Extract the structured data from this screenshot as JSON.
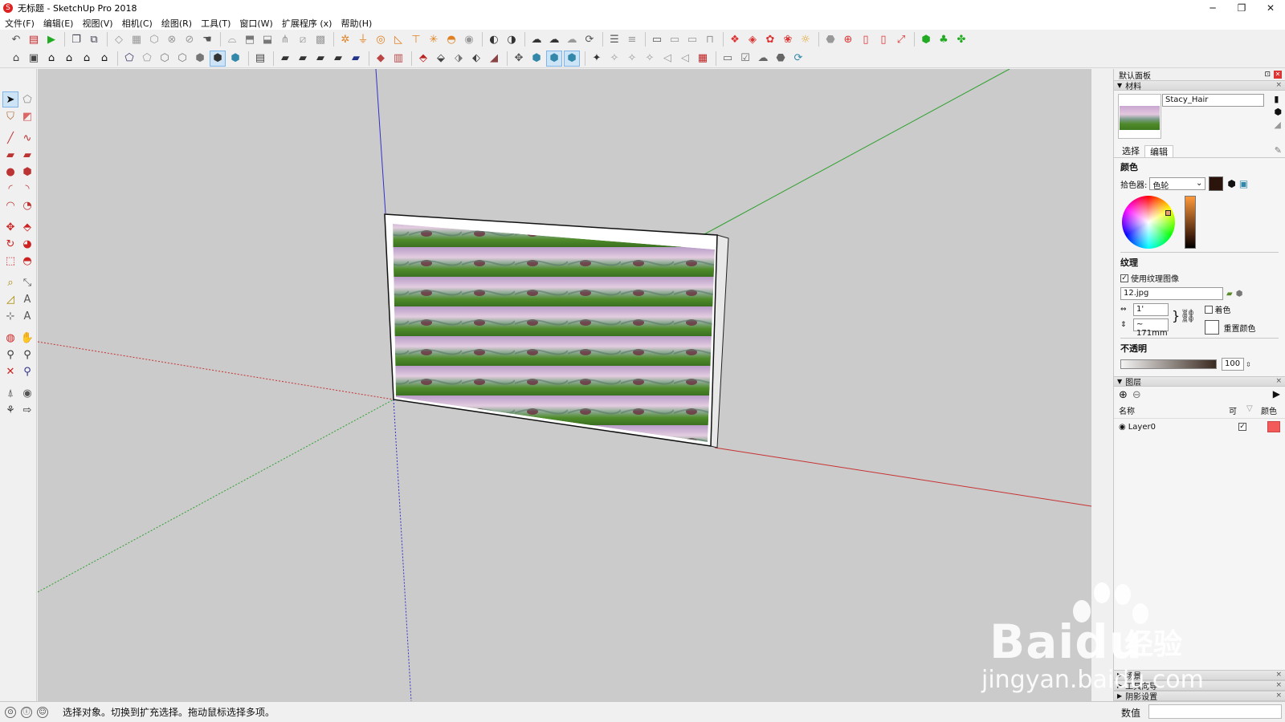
{
  "window": {
    "title": "无标题 - SketchUp Pro 2018",
    "minimize": "─",
    "maximize": "❐",
    "close": "✕"
  },
  "menu": [
    "文件(F)",
    "编辑(E)",
    "视图(V)",
    "相机(C)",
    "绘图(R)",
    "工具(T)",
    "窗口(W)",
    "扩展程序 (x)",
    "帮助(H)"
  ],
  "default_tray": {
    "title": "默认面板",
    "materials": {
      "header": "材料",
      "name": "Stacy_Hair",
      "tabs": [
        "选择",
        "编辑"
      ],
      "active_tab": "编辑",
      "color_section": "颜色",
      "picker_label": "拾色器:",
      "picker_value": "色轮",
      "texture_section": "纹理",
      "use_texture_label": "使用纹理图像",
      "use_texture_checked": "✓",
      "texture_file": "12.jpg",
      "width_value": "1'",
      "height_value": "~ 171mm",
      "colorize_label": "着色",
      "reset_color_label": "重置颜色",
      "opacity_section": "不透明",
      "opacity_value": "100"
    },
    "layers": {
      "header": "图层",
      "col_name": "名称",
      "col_visible": "可",
      "col_color": "颜色",
      "rows": [
        {
          "name": "Layer0",
          "visible": "✓",
          "color": "#f35a5a"
        }
      ]
    },
    "collapsed_trays": [
      "场景",
      "工具向导",
      "阴影设置"
    ]
  },
  "status": {
    "message": "选择对象。切换到扩充选择。拖动鼠标选择多项。",
    "vcb_label": "数值",
    "vcb_value": ""
  },
  "watermark": {
    "brand": "Bai",
    "brand2": "du",
    "cn": "经验",
    "url": "jingyan.baidu.com"
  },
  "colors": {
    "viewport_bg": "#cbcbcb",
    "axis_red": "#c83232",
    "axis_green": "#2ea02e",
    "axis_blue": "#3232c8",
    "current_color": "#2a140c"
  }
}
